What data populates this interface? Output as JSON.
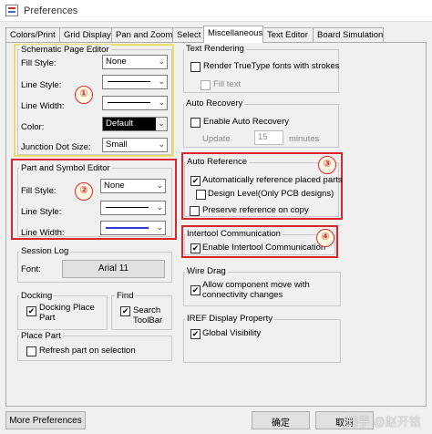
{
  "window": {
    "title": "Preferences"
  },
  "tabs": [
    {
      "label": "Colors/Print"
    },
    {
      "label": "Grid Display"
    },
    {
      "label": "Pan and Zoom"
    },
    {
      "label": "Select"
    },
    {
      "label": "Miscellaneous"
    },
    {
      "label": "Text Editor"
    },
    {
      "label": "Board Simulation"
    }
  ],
  "schematic_editor": {
    "title": "Schematic Page Editor",
    "fill_style_label": "Fill Style:",
    "fill_style_value": "None",
    "line_style_label": "Line Style:",
    "line_width_label": "Line Width:",
    "color_label": "Color:",
    "color_value": "Default",
    "junction_label": "Junction Dot Size:",
    "junction_value": "Small"
  },
  "part_editor": {
    "title": "Part and Symbol Editor",
    "fill_style_label": "Fill Style:",
    "fill_style_value": "None",
    "line_style_label": "Line Style:",
    "line_width_label": "Line Width:"
  },
  "session_log": {
    "title": "Session Log",
    "font_label": "Font:",
    "font_button": "Arial 11"
  },
  "docking": {
    "title": "Docking",
    "option": "Docking Place\nPart",
    "checked": true
  },
  "find": {
    "title": "Find",
    "option": "Search\nToolBar",
    "checked": true
  },
  "place_part": {
    "title": "Place Part",
    "option": "Refresh part on selection",
    "checked": false
  },
  "text_rendering": {
    "title": "Text Rendering",
    "option1": "Render TrueType fonts with strokes",
    "option1_checked": false,
    "option2": "Fill text",
    "option2_checked": false
  },
  "auto_recovery": {
    "title": "Auto Recovery",
    "option": "Enable Auto Recovery",
    "checked": false,
    "update_label": "Update",
    "update_value": "15",
    "minutes_label": "minutes"
  },
  "auto_reference": {
    "title": "Auto Reference",
    "option1": "Automatically reference placed parts",
    "option1_checked": true,
    "option2": "Design Level(Only PCB designs)",
    "option2_checked": false,
    "option3": "Preserve reference on copy",
    "option3_checked": false
  },
  "intertool": {
    "title": "Intertool Communication",
    "option": "Enable Intertool Communication",
    "checked": true
  },
  "wire_drag": {
    "title": "Wire Drag",
    "option": "Allow component move with\nconnectivity changes",
    "checked": true
  },
  "iref": {
    "title": "IREF Display Property",
    "option": "Global Visibility",
    "checked": true
  },
  "annotations": {
    "b1": "①",
    "b2": "②",
    "b3": "③",
    "b4": "④"
  },
  "buttons": {
    "more": "More Preferences",
    "ok": "确定",
    "cancel": "取消"
  },
  "watermark": "知乎 @赵开铭"
}
